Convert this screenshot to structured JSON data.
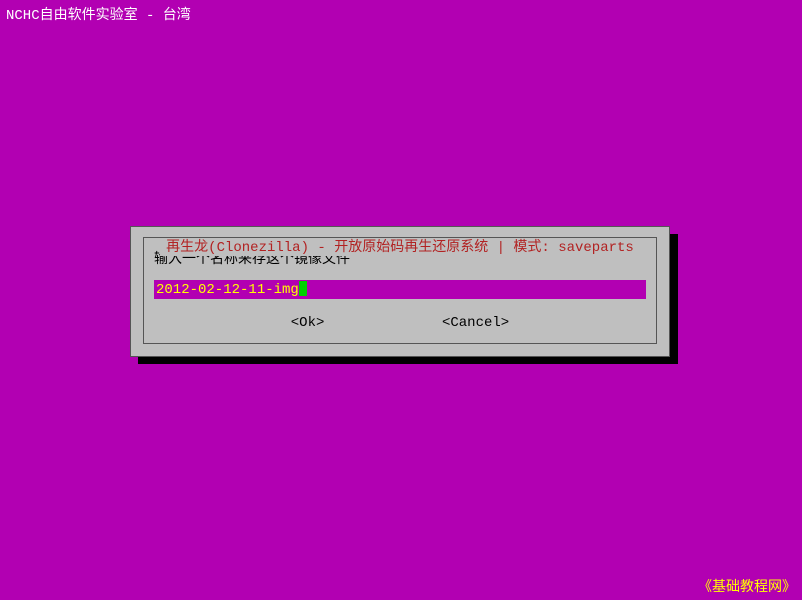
{
  "header": {
    "title": "NCHC自由软件实验室 - 台湾"
  },
  "dialog": {
    "title": "再生龙(Clonezilla) - 开放原始码再生还原系统 | 模式: saveparts",
    "prompt": "输入一个名称来存这个镜像文件",
    "input_value": "2012-02-12-11-img",
    "ok_label": "<Ok>",
    "cancel_label": "<Cancel>"
  },
  "footer": {
    "watermark": "《基础教程网》"
  }
}
